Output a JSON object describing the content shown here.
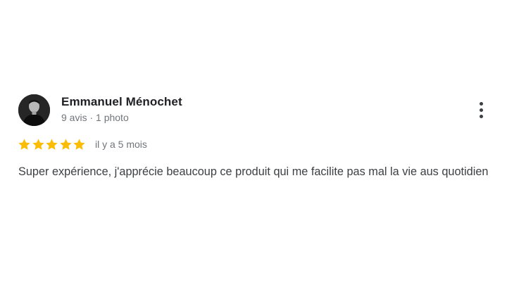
{
  "review": {
    "author_name": "Emmanuel Ménochet",
    "author_meta": "9 avis · 1 photo",
    "rating": 5,
    "rating_max": 5,
    "date": "il y a 5 mois",
    "text": "Super expérience, j'apprécie beaucoup ce produit qui me facilite pas mal la vie aus quotidien"
  },
  "icons": {
    "more": "more-vertical-icon",
    "star": "star-icon"
  },
  "colors": {
    "star": "#fbbc04",
    "name": "#202124",
    "meta": "#70757a",
    "text": "#3c4043"
  }
}
